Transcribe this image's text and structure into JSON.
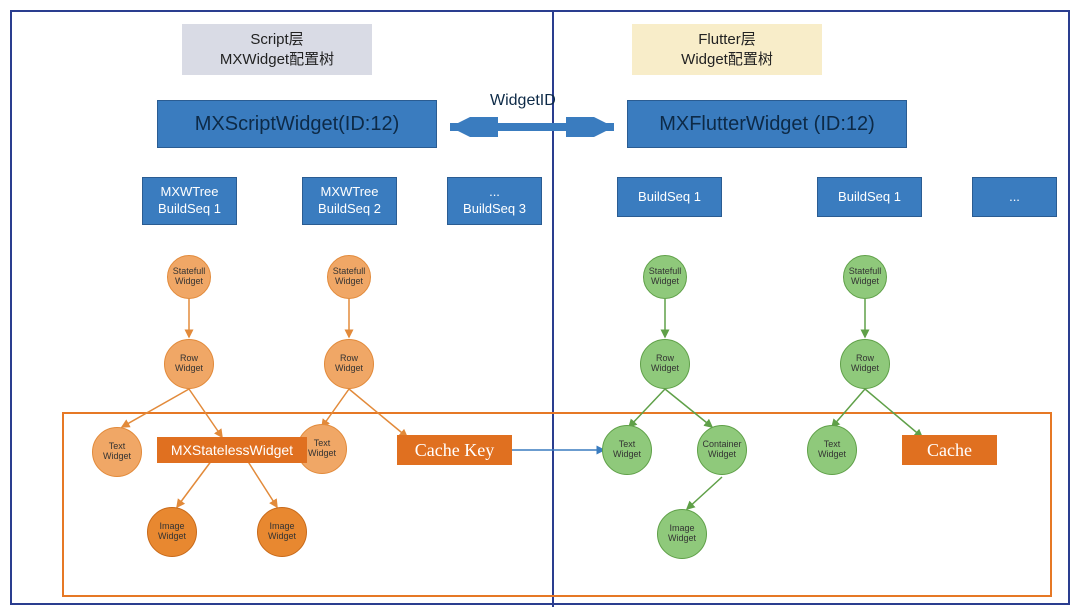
{
  "headers": {
    "left_line1": "Script层",
    "left_line2": "MXWidget配置树",
    "right_line1": "Flutter层",
    "right_line2": "Widget配置树"
  },
  "widget_id_label": "WidgetID",
  "main_widgets": {
    "left": "MXScriptWidget(ID:12)",
    "right": "MXFlutterWidget (ID:12)"
  },
  "seq_boxes": {
    "left1_line1": "MXWTree",
    "left1_line2": "BuildSeq 1",
    "left2_line1": "MXWTree",
    "left2_line2": "BuildSeq 2",
    "left3_line1": "...",
    "left3_line2": "BuildSeq 3",
    "right1": "BuildSeq 1",
    "right2": "BuildSeq 1",
    "right3": "..."
  },
  "nodes": {
    "statefull": "Statefull\nWidget",
    "row": "Row\nWidget",
    "text": "Text\nWidget",
    "image": "Image\nWidget",
    "container": "Container\nWidget"
  },
  "stateless_label": "MXStatelessWidget",
  "cache_key_label": "Cache Key",
  "cache_label": "Cache",
  "colors": {
    "frame": "#2a3d8f",
    "blue_box": "#3a7cbf",
    "orange_box": "#e07020",
    "orange_light": "#f0a766",
    "orange_dark": "#e88830",
    "green": "#8fc97b",
    "header_left": "#d9dbe5",
    "header_right": "#f8edc9"
  }
}
